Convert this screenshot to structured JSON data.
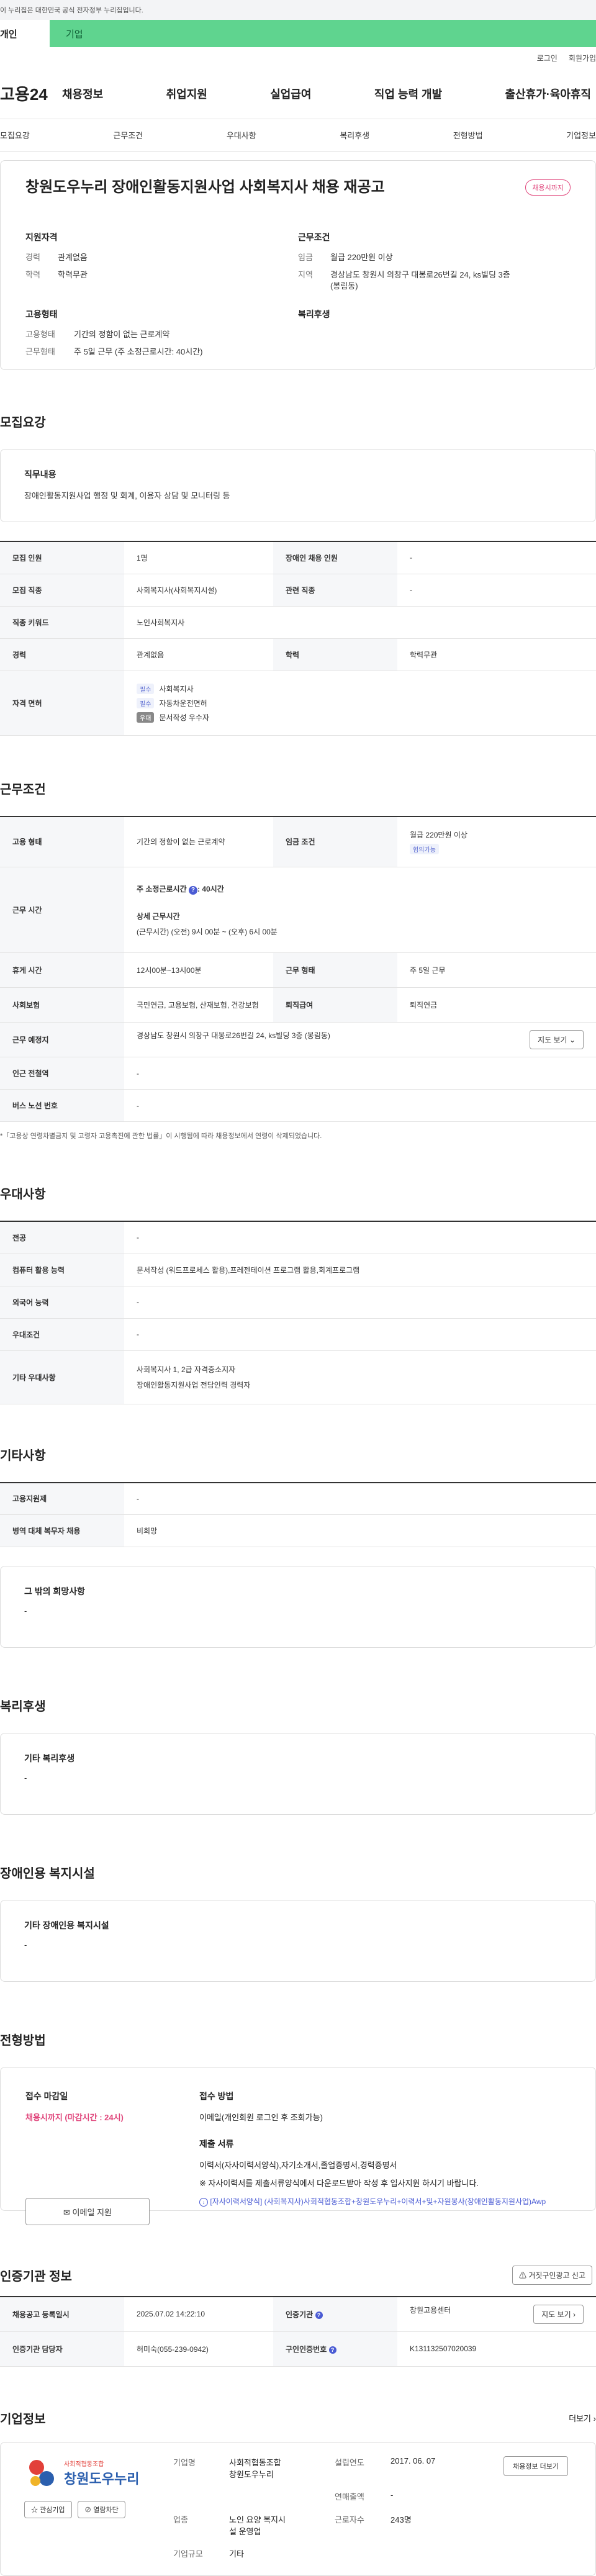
{
  "gov_banner": "이 누리집은 대한민국 공식 전자정부 누리집입니다.",
  "user_tabs": {
    "personal": "개인",
    "company": "기업"
  },
  "util": {
    "login": "로그인",
    "signup": "회원가입"
  },
  "gnb": {
    "logo": "고용24",
    "menu": [
      "채용정보",
      "취업지원",
      "실업급여",
      "직업 능력 개발",
      "출산휴가·육아휴직"
    ]
  },
  "anchors": [
    "모집요강",
    "근무조건",
    "우대사항",
    "복리후생",
    "전형방법",
    "기업정보"
  ],
  "summary": {
    "title": "창원도우누리 장애인활동지원사업 사회복지사 채용 재공고",
    "status": "채용시까지",
    "qual_title": "지원자격",
    "qual": [
      {
        "k": "경력",
        "v": "관계없음"
      },
      {
        "k": "학력",
        "v": "학력무관"
      }
    ],
    "cond_title": "근무조건",
    "cond": [
      {
        "k": "임금",
        "v": "월급 220만원 이상"
      },
      {
        "k": "지역",
        "v": "경상남도 창원시 의창구 대봉로26번길 24, ks빌딩 3층 (봉림동)"
      }
    ],
    "emp_title": "고용형태",
    "emp": [
      {
        "k": "고용형태",
        "v": "기간의 정함이 없는 근로계약"
      },
      {
        "k": "근무형태",
        "v": "주 5일 근무 (주 소정근로시간: 40시간)"
      }
    ],
    "welfare_title": "복리후생"
  },
  "recruit": {
    "title": "모집요강",
    "job_desc_label": "직무내용",
    "job_desc": "장애인활동지원사업 행정 및 회계, 이용자 상담 및 모니터링 등",
    "rows": {
      "headcount_k": "모집 인원",
      "headcount_v": "1명",
      "disabled_k": "장애인 채용 인원",
      "disabled_v": "-",
      "job_k": "모집 직종",
      "job_v": "사회복지사(사회복지시설)",
      "related_k": "관련 직종",
      "related_v": "-",
      "keyword_k": "직종 키워드",
      "keyword_v": "노인사회복지사",
      "career_k": "경력",
      "career_v": "관계없음",
      "edu_k": "학력",
      "edu_v": "학력무관",
      "license_k": "자격 면허",
      "license": [
        {
          "tag": "필수",
          "name": "사회복지사"
        },
        {
          "tag": "필수",
          "name": "자동차운전면허"
        },
        {
          "tag": "우대",
          "name": "문서작성 우수자"
        }
      ]
    }
  },
  "work": {
    "title": "근무조건",
    "type_k": "고용 형태",
    "type_v": "기간의 정함이 없는 근로계약",
    "wage_k": "임금 조건",
    "wage_v": "월급 220만원 이상",
    "wage_tag": "협의가능",
    "hours_k": "근무 시간",
    "hours_week": "주 소정근로시간",
    "hours_week_num": "40시간",
    "hours_detail_label": "상세 근무시간",
    "hours_detail": "(근무시간) (오전) 9시 00분 ~ (오후) 6시 00분",
    "break_k": "휴게 시간",
    "break_v": "12시00분~13시00분",
    "form_k": "근무 형태",
    "form_v": "주 5일 근무",
    "insurance_k": "사회보험",
    "insurance_v": "국민연금, 고용보험, 산재보험, 건강보험",
    "retire_k": "퇴직급여",
    "retire_v": "퇴직연금",
    "place_k": "근무 예정지",
    "place_v": "경상남도 창원시 의창구 대봉로26번길 24, ks빌딩 3층 (봉림동)",
    "map_btn": "지도 보기",
    "subway_k": "인근 전철역",
    "subway_v": "-",
    "bus_k": "버스 노선 번호",
    "bus_v": "-",
    "note": "*「고용상 연령차별금지 및 고령자 고용촉진에 관한 법률」이 시행됨에 따라 채용정보에서 연령이 삭제되었습니다."
  },
  "pref": {
    "title": "우대사항",
    "major_k": "전공",
    "major_v": "-",
    "computer_k": "컴퓨터 활용 능력",
    "computer_v": "문서작성 (워드프로세스 활용),프레젠테이션 프로그램 활용,회계프로그램",
    "lang_k": "외국어 능력",
    "lang_v": "-",
    "cond_k": "우대조건",
    "cond_v": "-",
    "etc_k": "기타 우대사항",
    "etc_v1": "사회복지사 1, 2급 자격증소지자",
    "etc_v2": "장애인활동지원사업 전담인력 경력자"
  },
  "other": {
    "title": "기타사항",
    "support_k": "고용지원제",
    "support_v": "-",
    "military_k": "병역 대체 복무자 채용",
    "military_v": "비희망",
    "hope_label": "그 밖의 희망사항",
    "hope_v": "-"
  },
  "welfare": {
    "title": "복리후생",
    "label": "기타 복리후생",
    "value": "-"
  },
  "disabled_fac": {
    "title": "장애인용 복지시설",
    "label": "기타 장애인용 복지시설",
    "value": "-"
  },
  "process": {
    "title": "전형방법",
    "deadline_label": "접수 마감일",
    "deadline_value": "채용시까지 (마감시간 : 24시)",
    "email_btn": "이메일 지원",
    "method_label": "접수 방법",
    "method_value": "이메일(개인회원 로그인 후 조회가능)",
    "docs_label": "제출 서류",
    "docs_value": "이력서(자사이력서양식),자기소개서,졸업증명서,경력증명서",
    "docs_note": "※ 자사이력서를 제출서류양식에서 다운로드받아 작성 후 입사지원 하시기 바랍니다.",
    "docs_link": "[자사이력서양식] (사회복지사)사회적협동조합+창원도우누리+이력서+및+자원봉사(장애인활동지원사업)Awp"
  },
  "agency": {
    "title": "인증기관 정보",
    "report_btn": "거짓구인광고 신고",
    "reg_k": "채용공고 등록일시",
    "reg_v": "2025.07.02 14:22:10",
    "org_k": "인증기관",
    "org_v": "창원고용센터",
    "map_btn": "지도 보기",
    "mgr_k": "인증기관 담당자",
    "mgr_v": "허미숙(055-239-0942)",
    "cert_k": "구인인증번호",
    "cert_v": "K131132507020039"
  },
  "company": {
    "title": "기업정보",
    "more": "더보기",
    "logo_sub": "사회적협동조합",
    "logo_main": "창원도우누리",
    "fav_btn": "관심기업",
    "block_btn": "열람차단",
    "name_k": "기업명",
    "name_v1": "사회적협동조합",
    "name_v2": "창원도우누리",
    "est_k": "설립연도",
    "est_v": "2017. 06. 07",
    "sales_k": "연매출액",
    "sales_v": "-",
    "ind_k": "업종",
    "ind_v1": "노인 요양 복지시",
    "ind_v2": "설 운영업",
    "emp_k": "근로자수",
    "emp_v": "243명",
    "scale_k": "기업규모",
    "scale_v": "기타",
    "info_btn": "채용정보 더보기"
  },
  "colors": {
    "accent": "#5fd48f",
    "badge": "#e0457b",
    "deadline": "#e0457b",
    "link": "#4a5bd4"
  }
}
